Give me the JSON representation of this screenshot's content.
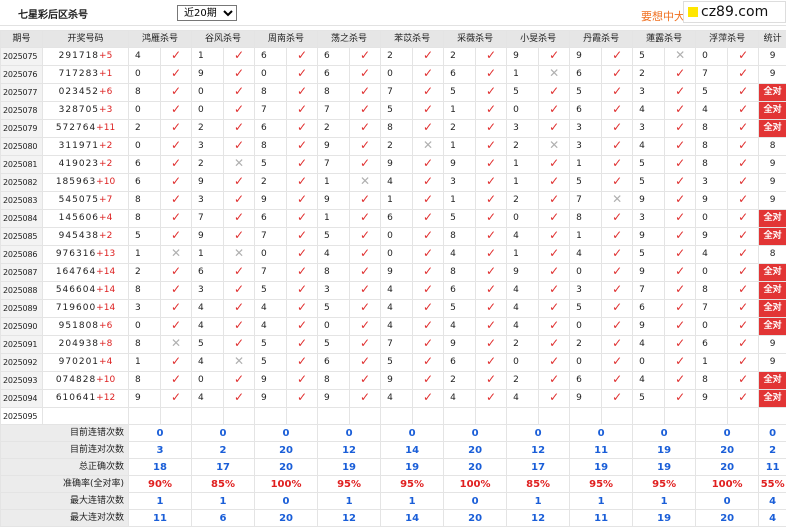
{
  "page": {
    "title": "七星彩后区杀号",
    "period_select": "近20期",
    "promo": "要想中大奖",
    "site": "cz89.com"
  },
  "headers": [
    "期号",
    "开奖号码",
    "鸿雁杀号",
    "谷风杀号",
    "周南杀号",
    "荡之杀号",
    "苯苡杀号",
    "采薇杀号",
    "小旻杀号",
    "丹霞杀号",
    "蓮露杀号",
    "浮萍杀号",
    "统计"
  ],
  "rows": [
    {
      "issue": "2025075",
      "digits": "291718",
      "sum": "+5",
      "kills": [
        [
          4,
          1
        ],
        [
          1,
          1
        ],
        [
          6,
          1
        ],
        [
          6,
          1
        ],
        [
          2,
          1
        ],
        [
          2,
          1
        ],
        [
          9,
          1
        ],
        [
          9,
          1
        ],
        [
          5,
          0
        ],
        [
          0,
          1
        ]
      ],
      "stat": "9"
    },
    {
      "issue": "2025076",
      "digits": "717283",
      "sum": "+1",
      "kills": [
        [
          0,
          1
        ],
        [
          9,
          1
        ],
        [
          0,
          1
        ],
        [
          6,
          1
        ],
        [
          0,
          1
        ],
        [
          6,
          1
        ],
        [
          1,
          0
        ],
        [
          6,
          1
        ],
        [
          2,
          1
        ],
        [
          7,
          1
        ]
      ],
      "stat": "9"
    },
    {
      "issue": "2025077",
      "digits": "023452",
      "sum": "+6",
      "kills": [
        [
          8,
          1
        ],
        [
          0,
          1
        ],
        [
          8,
          1
        ],
        [
          8,
          1
        ],
        [
          7,
          1
        ],
        [
          5,
          1
        ],
        [
          5,
          1
        ],
        [
          5,
          1
        ],
        [
          3,
          1
        ],
        [
          5,
          1
        ]
      ],
      "stat": "全对"
    },
    {
      "issue": "2025078",
      "digits": "328705",
      "sum": "+3",
      "kills": [
        [
          0,
          1
        ],
        [
          0,
          1
        ],
        [
          7,
          1
        ],
        [
          7,
          1
        ],
        [
          5,
          1
        ],
        [
          1,
          1
        ],
        [
          0,
          1
        ],
        [
          6,
          1
        ],
        [
          4,
          1
        ],
        [
          4,
          1
        ]
      ],
      "stat": "全对"
    },
    {
      "issue": "2025079",
      "digits": "572764",
      "sum": "+11",
      "kills": [
        [
          2,
          1
        ],
        [
          2,
          1
        ],
        [
          6,
          1
        ],
        [
          2,
          1
        ],
        [
          8,
          1
        ],
        [
          2,
          1
        ],
        [
          3,
          1
        ],
        [
          3,
          1
        ],
        [
          3,
          1
        ],
        [
          8,
          1
        ]
      ],
      "stat": "全对"
    },
    {
      "issue": "2025080",
      "digits": "311971",
      "sum": "+2",
      "kills": [
        [
          0,
          1
        ],
        [
          3,
          1
        ],
        [
          8,
          1
        ],
        [
          9,
          1
        ],
        [
          2,
          0
        ],
        [
          1,
          1
        ],
        [
          2,
          0
        ],
        [
          3,
          1
        ],
        [
          4,
          1
        ],
        [
          8,
          1
        ]
      ],
      "stat": "8"
    },
    {
      "issue": "2025081",
      "digits": "419023",
      "sum": "+2",
      "kills": [
        [
          6,
          1
        ],
        [
          2,
          0
        ],
        [
          5,
          1
        ],
        [
          7,
          1
        ],
        [
          9,
          1
        ],
        [
          9,
          1
        ],
        [
          1,
          1
        ],
        [
          1,
          1
        ],
        [
          5,
          1
        ],
        [
          8,
          1
        ]
      ],
      "stat": "9"
    },
    {
      "issue": "2025082",
      "digits": "185963",
      "sum": "+10",
      "kills": [
        [
          6,
          1
        ],
        [
          9,
          1
        ],
        [
          2,
          1
        ],
        [
          1,
          0
        ],
        [
          4,
          1
        ],
        [
          3,
          1
        ],
        [
          1,
          1
        ],
        [
          5,
          1
        ],
        [
          5,
          1
        ],
        [
          3,
          1
        ]
      ],
      "stat": "9"
    },
    {
      "issue": "2025083",
      "digits": "545075",
      "sum": "+7",
      "kills": [
        [
          8,
          1
        ],
        [
          3,
          1
        ],
        [
          9,
          1
        ],
        [
          9,
          1
        ],
        [
          1,
          1
        ],
        [
          1,
          1
        ],
        [
          2,
          1
        ],
        [
          7,
          0
        ],
        [
          9,
          1
        ],
        [
          9,
          1
        ]
      ],
      "stat": "9"
    },
    {
      "issue": "2025084",
      "digits": "145606",
      "sum": "+4",
      "kills": [
        [
          8,
          1
        ],
        [
          7,
          1
        ],
        [
          6,
          1
        ],
        [
          1,
          1
        ],
        [
          6,
          1
        ],
        [
          5,
          1
        ],
        [
          0,
          1
        ],
        [
          8,
          1
        ],
        [
          3,
          1
        ],
        [
          0,
          1
        ]
      ],
      "stat": "全对"
    },
    {
      "issue": "2025085",
      "digits": "945438",
      "sum": "+2",
      "kills": [
        [
          5,
          1
        ],
        [
          9,
          1
        ],
        [
          7,
          1
        ],
        [
          5,
          1
        ],
        [
          0,
          1
        ],
        [
          8,
          1
        ],
        [
          4,
          1
        ],
        [
          1,
          1
        ],
        [
          9,
          1
        ],
        [
          9,
          1
        ]
      ],
      "stat": "全对"
    },
    {
      "issue": "2025086",
      "digits": "976316",
      "sum": "+13",
      "kills": [
        [
          1,
          0
        ],
        [
          1,
          0
        ],
        [
          0,
          1
        ],
        [
          4,
          1
        ],
        [
          0,
          1
        ],
        [
          4,
          1
        ],
        [
          1,
          1
        ],
        [
          4,
          1
        ],
        [
          5,
          1
        ],
        [
          4,
          1
        ]
      ],
      "stat": "8"
    },
    {
      "issue": "2025087",
      "digits": "164764",
      "sum": "+14",
      "kills": [
        [
          2,
          1
        ],
        [
          6,
          1
        ],
        [
          7,
          1
        ],
        [
          8,
          1
        ],
        [
          9,
          1
        ],
        [
          8,
          1
        ],
        [
          9,
          1
        ],
        [
          0,
          1
        ],
        [
          9,
          1
        ],
        [
          0,
          1
        ]
      ],
      "stat": "全对"
    },
    {
      "issue": "2025088",
      "digits": "546604",
      "sum": "+14",
      "kills": [
        [
          8,
          1
        ],
        [
          3,
          1
        ],
        [
          5,
          1
        ],
        [
          3,
          1
        ],
        [
          4,
          1
        ],
        [
          6,
          1
        ],
        [
          4,
          1
        ],
        [
          3,
          1
        ],
        [
          7,
          1
        ],
        [
          8,
          1
        ]
      ],
      "stat": "全对"
    },
    {
      "issue": "2025089",
      "digits": "719600",
      "sum": "+14",
      "kills": [
        [
          3,
          1
        ],
        [
          4,
          1
        ],
        [
          4,
          1
        ],
        [
          5,
          1
        ],
        [
          4,
          1
        ],
        [
          5,
          1
        ],
        [
          4,
          1
        ],
        [
          5,
          1
        ],
        [
          6,
          1
        ],
        [
          7,
          1
        ]
      ],
      "stat": "全对"
    },
    {
      "issue": "2025090",
      "digits": "951808",
      "sum": "+6",
      "kills": [
        [
          0,
          1
        ],
        [
          4,
          1
        ],
        [
          4,
          1
        ],
        [
          0,
          1
        ],
        [
          4,
          1
        ],
        [
          4,
          1
        ],
        [
          4,
          1
        ],
        [
          0,
          1
        ],
        [
          9,
          1
        ],
        [
          0,
          1
        ]
      ],
      "stat": "全对"
    },
    {
      "issue": "2025091",
      "digits": "204938",
      "sum": "+8",
      "kills": [
        [
          8,
          0
        ],
        [
          5,
          1
        ],
        [
          5,
          1
        ],
        [
          5,
          1
        ],
        [
          7,
          1
        ],
        [
          9,
          1
        ],
        [
          2,
          1
        ],
        [
          2,
          1
        ],
        [
          4,
          1
        ],
        [
          6,
          1
        ]
      ],
      "stat": "9"
    },
    {
      "issue": "2025092",
      "digits": "970201",
      "sum": "+4",
      "kills": [
        [
          1,
          1
        ],
        [
          4,
          0
        ],
        [
          5,
          1
        ],
        [
          6,
          1
        ],
        [
          5,
          1
        ],
        [
          6,
          1
        ],
        [
          0,
          1
        ],
        [
          0,
          1
        ],
        [
          0,
          1
        ],
        [
          1,
          1
        ]
      ],
      "stat": "9"
    },
    {
      "issue": "2025093",
      "digits": "074828",
      "sum": "+10",
      "kills": [
        [
          8,
          1
        ],
        [
          0,
          1
        ],
        [
          9,
          1
        ],
        [
          8,
          1
        ],
        [
          9,
          1
        ],
        [
          2,
          1
        ],
        [
          2,
          1
        ],
        [
          6,
          1
        ],
        [
          4,
          1
        ],
        [
          8,
          1
        ]
      ],
      "stat": "全对"
    },
    {
      "issue": "2025094",
      "digits": "610641",
      "sum": "+12",
      "kills": [
        [
          9,
          1
        ],
        [
          4,
          1
        ],
        [
          9,
          1
        ],
        [
          9,
          1
        ],
        [
          4,
          1
        ],
        [
          4,
          1
        ],
        [
          4,
          1
        ],
        [
          9,
          1
        ],
        [
          5,
          1
        ],
        [
          9,
          1
        ]
      ],
      "stat": "全对"
    }
  ],
  "current": {
    "issue": "2025095",
    "label": "当前期杀号",
    "predictions": [
      "9",
      "5",
      "0",
      "2",
      "4",
      "4",
      "4",
      "4",
      "6",
      "1"
    ]
  },
  "stats": [
    {
      "label": "目前连错次数",
      "values": [
        "0",
        "0",
        "0",
        "0",
        "0",
        "0",
        "0",
        "0",
        "0",
        "0",
        "0"
      ],
      "rate": false
    },
    {
      "label": "目前连对次数",
      "values": [
        "3",
        "2",
        "20",
        "12",
        "14",
        "20",
        "12",
        "11",
        "19",
        "20",
        "2"
      ],
      "rate": false
    },
    {
      "label": "总正确次数",
      "values": [
        "18",
        "17",
        "20",
        "19",
        "19",
        "20",
        "17",
        "19",
        "19",
        "20",
        "11"
      ],
      "rate": false
    },
    {
      "label": "准确率(全对率)",
      "values": [
        "90%",
        "85%",
        "100%",
        "95%",
        "95%",
        "100%",
        "85%",
        "95%",
        "95%",
        "100%",
        "55%"
      ],
      "rate": true
    },
    {
      "label": "最大连错次数",
      "values": [
        "1",
        "1",
        "0",
        "1",
        "1",
        "0",
        "1",
        "1",
        "1",
        "0",
        "4"
      ],
      "rate": false
    },
    {
      "label": "最大连对次数",
      "values": [
        "11",
        "6",
        "20",
        "12",
        "14",
        "20",
        "12",
        "11",
        "19",
        "20",
        "4"
      ],
      "rate": false
    }
  ]
}
